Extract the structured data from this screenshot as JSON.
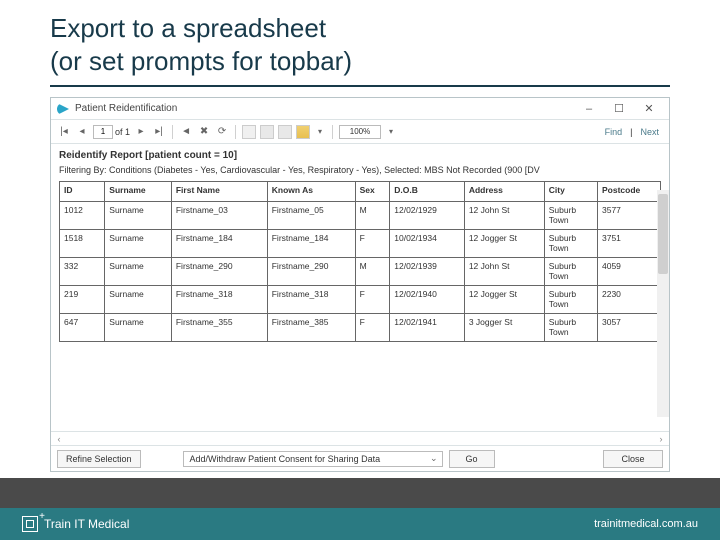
{
  "slide": {
    "title_line1": "Export to a spreadsheet",
    "title_line2": "(or set prompts for topbar)"
  },
  "window": {
    "title": "Patient Reidentification",
    "minimize": "–",
    "maximize": "☐",
    "close": "✕"
  },
  "toolbar": {
    "nav_first": "|◂",
    "nav_prev": "◂",
    "page_current": "1",
    "page_of": "of 1",
    "nav_next": "▸",
    "nav_last": "▸|",
    "refresh": "⟳",
    "stop": "✖",
    "zoom": "100%",
    "find": "Find",
    "sep": "|",
    "next": "Next"
  },
  "report": {
    "title": "Reidentify Report  [patient count = 10]",
    "filter": "Filtering By: Conditions (Diabetes - Yes, Cardiovascular - Yes, Respiratory - Yes), Selected: MBS Not Recorded (900 [DV"
  },
  "columns": {
    "id": "ID",
    "surname": "Surname",
    "firstname": "First Name",
    "knownas": "Known As",
    "sex": "Sex",
    "dob": "D.O.B",
    "address": "Address",
    "city": "City",
    "postcode": "Postcode"
  },
  "rows": [
    {
      "id": "1012",
      "surname": "Surname",
      "firstname": "Firstname_03",
      "knownas": "Firstname_05",
      "sex": "M",
      "dob": "12/02/1929",
      "address": "12 John St",
      "city": "Suburb Town",
      "postcode": "3577"
    },
    {
      "id": "1518",
      "surname": "Surname",
      "firstname": "Firstname_184",
      "knownas": "Firstname_184",
      "sex": "F",
      "dob": "10/02/1934",
      "address": "12 Jogger St",
      "city": "Suburb Town",
      "postcode": "3751"
    },
    {
      "id": "332",
      "surname": "Surname",
      "firstname": "Firstname_290",
      "knownas": "Firstname_290",
      "sex": "M",
      "dob": "12/02/1939",
      "address": "12 John St",
      "city": "Suburb Town",
      "postcode": "4059"
    },
    {
      "id": "219",
      "surname": "Surname",
      "firstname": "Firstname_318",
      "knownas": "Firstname_318",
      "sex": "F",
      "dob": "12/02/1940",
      "address": "12 Jogger St",
      "city": "Suburb Town",
      "postcode": "2230"
    },
    {
      "id": "647",
      "surname": "Surname",
      "firstname": "Firstname_355",
      "knownas": "Firstname_385",
      "sex": "F",
      "dob": "12/02/1941",
      "address": "3 Jogger St",
      "city": "Suburb Town",
      "postcode": "3057"
    }
  ],
  "footer": {
    "refine": "Refine Selection",
    "action_selected": "Add/Withdraw Patient Consent for Sharing Data",
    "go": "Go",
    "close": "Close"
  },
  "brand": {
    "name": "Train IT Medical",
    "url": "trainitmedical.com.au"
  }
}
